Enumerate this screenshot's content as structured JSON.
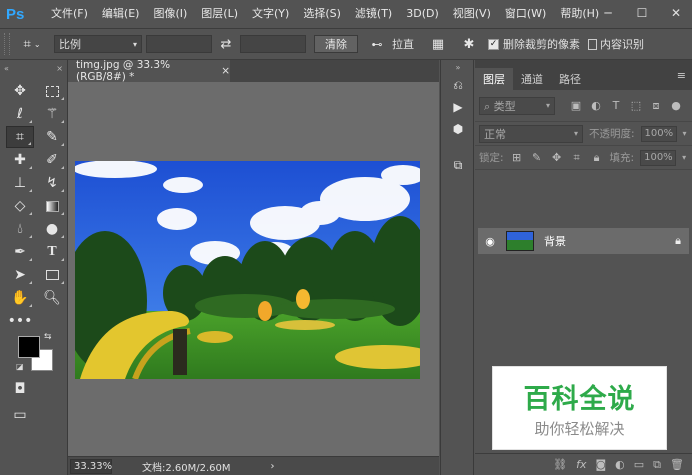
{
  "app": {
    "logo": "Ps"
  },
  "menu": [
    "文件(F)",
    "编辑(E)",
    "图像(I)",
    "图层(L)",
    "文字(Y)",
    "选择(S)",
    "滤镜(T)",
    "3D(D)",
    "视图(V)",
    "窗口(W)",
    "帮助(H)"
  ],
  "window_controls": {
    "minimize": "─",
    "maximize": "☐",
    "close": "✕"
  },
  "options": {
    "ratio_select": "比例",
    "clear_button": "清除",
    "straighten_label": "拉直",
    "delete_cropped_label": "删除裁剪的像素",
    "delete_cropped_checked": true,
    "content_aware_label": "内容识别"
  },
  "document": {
    "tab_title": "timg.jpg @ 33.3%(RGB/8#) *",
    "tab_close": "×",
    "zoom": "33.33%",
    "doc_info": "文档:2.60M/2.60M",
    "status_arrow": "›"
  },
  "layers_panel": {
    "tabs": [
      "图层",
      "通道",
      "路径"
    ],
    "active_tab": 0,
    "filter_kind": "类型",
    "blend_mode": "正常",
    "opacity_label": "不透明度:",
    "opacity_value": "100%",
    "lock_label": "锁定:",
    "fill_label": "填充:",
    "fill_value": "100%",
    "layer": {
      "name": "背景",
      "visible": true,
      "locked": true
    }
  },
  "watermark": {
    "title": "百科全说",
    "subtitle": "助你轻松解决"
  },
  "colors": {
    "foreground": "#000000",
    "background": "#ffffff",
    "accent": "#31a8ff",
    "watermark_green": "#2eaa4a"
  },
  "icons": {
    "tools": [
      "move-icon",
      "marquee-icon",
      "lasso-icon",
      "magic-wand-icon",
      "crop-icon",
      "eyedropper-icon",
      "healing-icon",
      "brush-icon",
      "stamp-icon",
      "history-brush-icon",
      "eraser-icon",
      "gradient-icon",
      "blur-icon",
      "dodge-icon",
      "pen-icon",
      "type-icon",
      "path-select-icon",
      "rectangle-icon",
      "hand-icon",
      "zoom-icon",
      "more-icon"
    ]
  }
}
